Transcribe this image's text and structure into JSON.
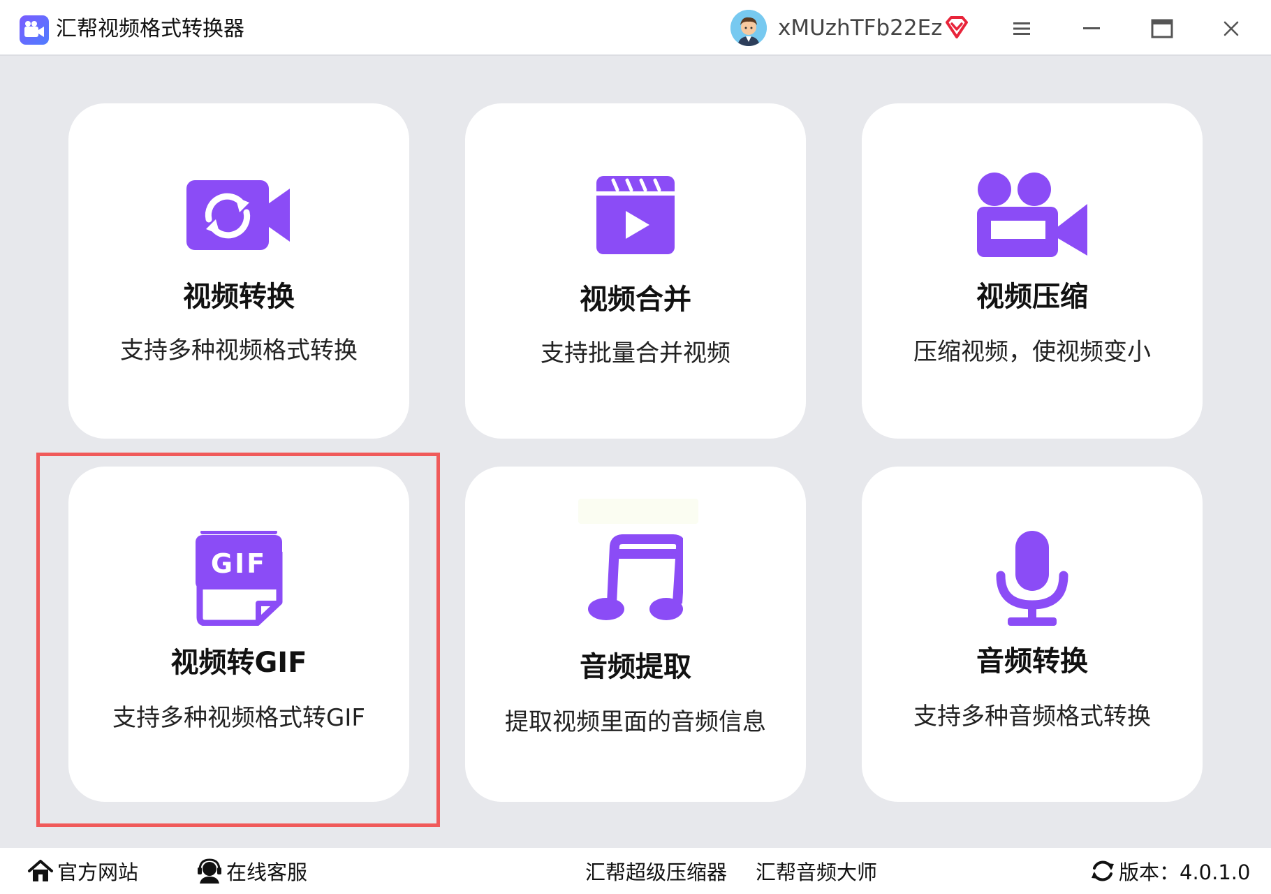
{
  "window": {
    "title": "汇帮视频格式转换器",
    "username": "xMUzhTFb22Ez"
  },
  "colors": {
    "accent": "#8b4cf6",
    "highlight_border": "#f05a5a",
    "background": "#e7e8ec",
    "card": "#ffffff"
  },
  "cards": [
    {
      "title": "视频转换",
      "desc": "支持多种视频格式转换",
      "icon": "video-convert-icon"
    },
    {
      "title": "视频合并",
      "desc": "支持批量合并视频",
      "icon": "clapperboard-play-icon"
    },
    {
      "title": "视频压缩",
      "desc": "压缩视频，使视频变小",
      "icon": "video-camera-icon"
    },
    {
      "title": "视频转GIF",
      "desc": "支持多种视频格式转GIF",
      "icon": "gif-file-icon"
    },
    {
      "title": "音频提取",
      "desc": "提取视频里面的音频信息",
      "icon": "music-note-icon"
    },
    {
      "title": "音频转换",
      "desc": "支持多种音频格式转换",
      "icon": "microphone-icon"
    }
  ],
  "footer": {
    "website": "官方网站",
    "service": "在线客服",
    "compressor": "汇帮超级压缩器",
    "audio_master": "汇帮音频大师",
    "version": "版本：4.0.1.0"
  }
}
